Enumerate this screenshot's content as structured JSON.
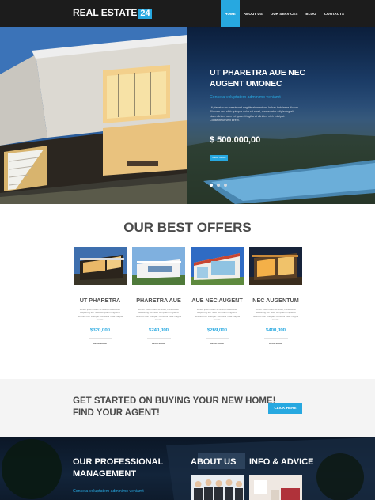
{
  "header": {
    "logo_text": "REAL ESTATE",
    "logo_badge": "24",
    "nav": [
      "HOME",
      "ABOUT US",
      "OUR SERVICES",
      "BLOG",
      "CONTACTS"
    ]
  },
  "hero": {
    "title": "UT PHARETRA AUE NEC AUGENT UMONEC",
    "subtitle": "Conseta voluptatem adminimo veniamt",
    "body": "Ut planetarum mauris sed sagittis elementum. In hac habitasse dictum. Aliquam orci nibh quisque dolor sit amet, consectetur adipiscing elit. Nam ultrices sem vel quam fringilla et ultricies nibh volutpat. Consectetur velit lorem.",
    "price": "$ 500.000,00",
    "button": "READ MORE"
  },
  "offers": {
    "title": "OUR BEST OFFERS",
    "items": [
      {
        "name": "UT PHARETRA",
        "desc": "Lorem ipsum dolor sit amet, consectetur adipiscing elit. Nam vel quam fringilla ut ultricies nibh volutpat. Curabitur vitae magna mauris.",
        "price": "$320,000",
        "more": "READ MORE"
      },
      {
        "name": "PHARETRA AUE",
        "desc": "Lorem ipsum dolor sit amet, consectetur adipiscing elit. Nam vel quam fringilla ut ultricies nibh volutpat. Curabitur vitae magna mauris.",
        "price": "$240,000",
        "more": "READ MORE"
      },
      {
        "name": "AUE NEC AUGENT",
        "desc": "Lorem ipsum dolor sit amet, consectetur adipiscing elit. Nam vel quam fringilla ut ultricies nibh volutpat. Curabitur vitae magna mauris.",
        "price": "$269,000",
        "more": "READ MORE"
      },
      {
        "name": "NEC AUGENTUM",
        "desc": "Lorem ipsum dolor sit amet, consectetur adipiscing elit. Nam vel quam fringilla ut ultricies nibh volutpat. Curabitur vitae magna mauris.",
        "price": "$400,000",
        "more": "READ MORE"
      }
    ]
  },
  "cta": {
    "line1": "GET STARTED ON BUYING YOUR NEW HOME!",
    "line2": "FIND YOUR AGENT!",
    "button": "CLICK HERE"
  },
  "band": {
    "management_l1": "OUR PROFESSIONAL",
    "management_l2": "MANAGEMENT",
    "management_sub": "Conseta voluptatem adminimo veniamt",
    "about": "ABOUT US",
    "info": "INFO & ADVICE"
  },
  "colors": {
    "accent": "#27a8e0",
    "header_bg": "#1c1c1c",
    "heading": "#4a4a4a"
  }
}
